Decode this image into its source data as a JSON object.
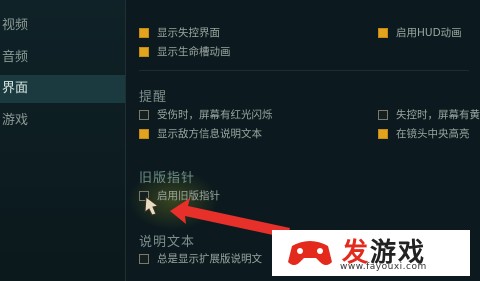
{
  "sidebar": {
    "items": [
      {
        "label": "视频"
      },
      {
        "label": "音频"
      },
      {
        "label": "界面"
      },
      {
        "label": "游戏"
      }
    ]
  },
  "sections": {
    "top": {
      "options": [
        {
          "label": "显示失控界面",
          "checked": true
        },
        {
          "label": "启用HUD动画",
          "checked": true
        },
        {
          "label": "显示生命槽动画",
          "checked": true
        }
      ]
    },
    "reminder": {
      "title": "提醒",
      "options": [
        {
          "label": "受伤时，屏幕有红光闪烁",
          "checked": false
        },
        {
          "label": "失控时，屏幕有黄",
          "checked": false
        },
        {
          "label": "显示敌方信息说明文本",
          "checked": true
        },
        {
          "label": "在镜头中央高亮",
          "checked": true
        }
      ]
    },
    "legacy": {
      "title": "旧版指针",
      "options": [
        {
          "label": "启用旧版指针",
          "checked": false
        }
      ]
    },
    "description": {
      "title": "说明文本",
      "options": [
        {
          "label": "总是显示扩展版说明文",
          "checked": false
        }
      ]
    }
  },
  "watermark": {
    "brand_left": "发",
    "brand_right": "游戏",
    "url": "www.fayouxi.com"
  },
  "colors": {
    "accent_checkbox": "#e3a31c",
    "arrow": "#e8302a",
    "active_nav_bg": "#1b3a3f"
  }
}
